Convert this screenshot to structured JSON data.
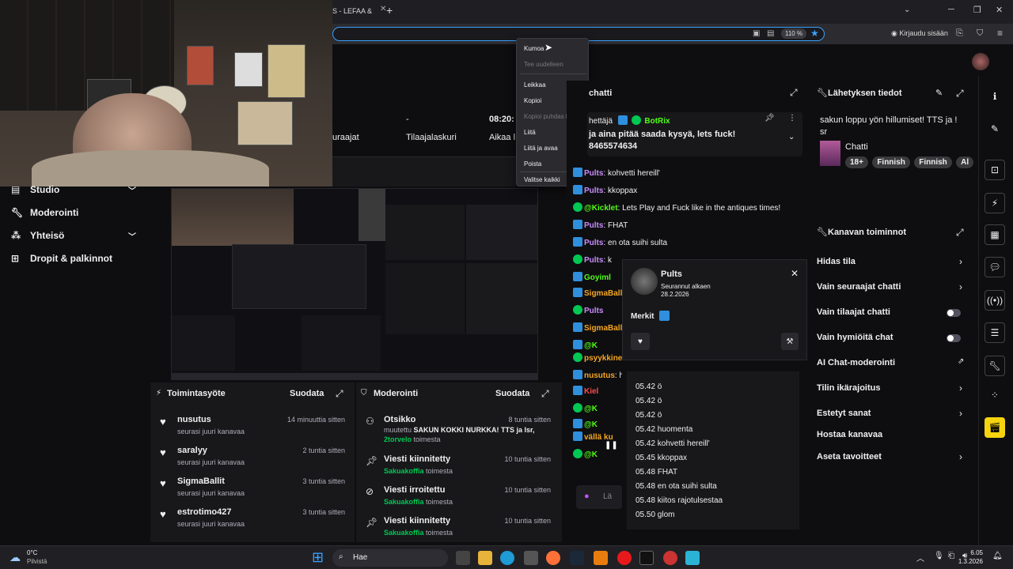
{
  "browser": {
    "tab_title": "S - LEFAA &",
    "zoom": "110 %",
    "login_label": "Kirjaudu sisään"
  },
  "stats": {
    "subs_value": "-",
    "subs_label": "Tilaajalaskuri",
    "followers_label": "uraajat",
    "time_value": "08:20:",
    "time_label": "Aikaa l"
  },
  "context_menu": {
    "items": [
      "Kumoa",
      "Tee uudelleen",
      "Leikkaa",
      "Kopioi",
      "Kopioi puhdas linkki",
      "Liitä",
      "Liitä ja avaa",
      "Poista",
      "Valitse kaikki"
    ]
  },
  "left_nav": {
    "items": [
      {
        "label": "Studio"
      },
      {
        "label": "Moderointi"
      },
      {
        "label": "Yhteisö"
      },
      {
        "label": "Dropit & palkinnot"
      }
    ]
  },
  "activity": {
    "title": "Toimintasyöte",
    "filter": "Suodata",
    "items": [
      {
        "user": "nusutus",
        "desc": "seurasi juuri kanavaa",
        "time": "14 minuuttia sitten"
      },
      {
        "user": "saralyy",
        "desc": "seurasi juuri kanavaa",
        "time": "2 tuntia sitten"
      },
      {
        "user": "SigmaBallit",
        "desc": "seurasi juuri kanavaa",
        "time": "3 tuntia sitten"
      },
      {
        "user": "estrotimo427",
        "desc": "seurasi juuri kanavaa",
        "time": "3 tuntia sitten"
      }
    ]
  },
  "moderation": {
    "title": "Moderointi",
    "filter": "Suodata",
    "items": [
      {
        "title": "Otsikko",
        "time": "8 tuntia sitten",
        "line1a": "muutettu ",
        "line1b": "SAKUN KOKKI NURKKA! TTS ja lsr,",
        "user": "2torvelo",
        "suffix": " toimesta"
      },
      {
        "title": "Viesti kiinnitetty",
        "time": "10 tuntia sitten",
        "user": "Sakuakoffia",
        "suffix": " toimesta"
      },
      {
        "title": "Viesti irroitettu",
        "time": "10 tuntia sitten",
        "user": "Sakuakoffia",
        "suffix": " toimesta"
      },
      {
        "title": "Viesti kiinnitetty",
        "time": "10 tuntia sitten",
        "user": "Sakuakoffia",
        "suffix": " toimesta"
      }
    ]
  },
  "chat": {
    "title": "chatti",
    "pinned_by": "hettäjä",
    "pinned_user": "BotRix",
    "pinned_line1": "ja aina pitää saada kysyä, lets fuck!",
    "pinned_line2": "8465574634",
    "lines": [
      {
        "user": "Pults",
        "text": ": kohvetti hereill'"
      },
      {
        "user": "Pults",
        "text": ": kkoppax"
      },
      {
        "user": "@Kicklet",
        "text": ": Lets Play and Fuck like in the antiques times!"
      },
      {
        "user": "Pults",
        "text": ": FHAT"
      },
      {
        "user": "Pults",
        "text": ": en ota suihi sulta"
      },
      {
        "user": "Pults",
        "text": ": k"
      },
      {
        "user": "Goyiml",
        "text": ""
      },
      {
        "user": "SigmaBalli",
        "text": ""
      },
      {
        "user": "Pults",
        "text": ""
      },
      {
        "user": "SigmaBalli",
        "text": ""
      },
      {
        "user": "@K",
        "text": ""
      },
      {
        "user": "psyykkiner",
        "text": ""
      },
      {
        "user": "nusutus",
        "text": ": h"
      },
      {
        "user": "Kiel",
        "text": ""
      },
      {
        "user": "@K",
        "text": ""
      },
      {
        "user": "@K",
        "text": ""
      },
      {
        "user": "vällä ku",
        "text": ""
      },
      {
        "user": "@K",
        "text": ""
      }
    ],
    "input_placeholder": "Lä"
  },
  "user_card": {
    "name": "Pults",
    "followed_label": "Seurannut alkaen",
    "followed_date": "28.2.2026",
    "badges_label": "Merkit",
    "messages": [
      "05.42 ö",
      "05.42 ö",
      "05.42 ö",
      "05.42 huomenta",
      "05.42 kohvetti hereill'",
      "05.45 kkoppax",
      "05.48 FHAT",
      "05.48 en ota suihi sulta",
      "05.48 kiitos rajotulsestaa",
      "05.50 glom"
    ]
  },
  "stream_info": {
    "title": "Lähetyksen tiedot",
    "stream_title": "sakun loppu yön hillumiset! TTS ja !",
    "stream_title2": "sr",
    "category": "Chatti",
    "tags": [
      "18+",
      "Finnish",
      "Finnish",
      "Al"
    ]
  },
  "channel_actions": {
    "title": "Kanavan toiminnot",
    "items": [
      {
        "label": "Hidas tila",
        "control": "chevron"
      },
      {
        "label": "Vain seuraajat chatti",
        "control": "chevron"
      },
      {
        "label": "Vain tilaajat chatti",
        "control": "switch"
      },
      {
        "label": "Vain hymiöitä chat",
        "control": "switch"
      },
      {
        "label": "AI Chat-moderointi",
        "control": "external"
      },
      {
        "label": "Tilin ikärajoitus",
        "control": "chevron"
      },
      {
        "label": "Estetyt sanat",
        "control": "chevron"
      },
      {
        "label": "Hostaa kanavaa",
        "control": "none"
      },
      {
        "label": "Aseta tavoitteet",
        "control": "chevron"
      }
    ]
  },
  "taskbar": {
    "weather_temp": "0°C",
    "weather_desc": "Pilvistä",
    "search_label": "Hae",
    "time": "6.05",
    "date": "1.3.2026"
  },
  "colors": {
    "kick_green": "#53fc18",
    "accent_blue": "#3aa0ff",
    "badge_blue": "#2f8fdd",
    "switch_off": "#53535f"
  }
}
